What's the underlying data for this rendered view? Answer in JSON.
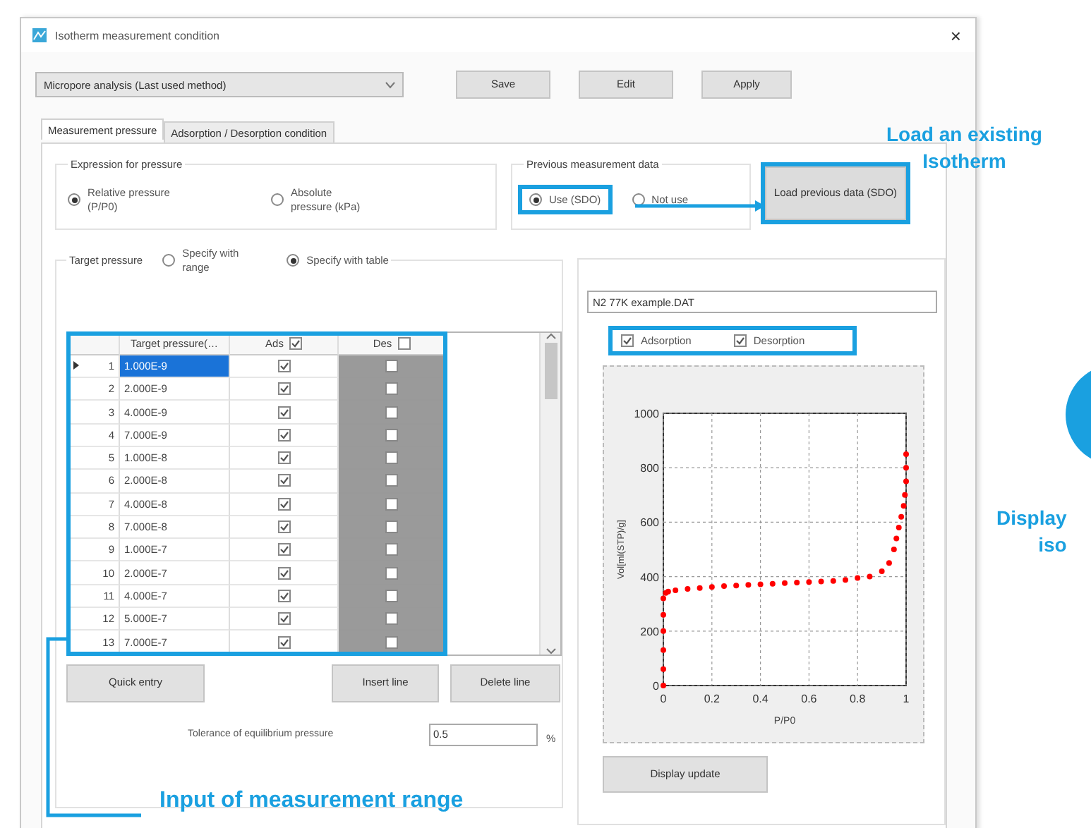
{
  "window": {
    "title": "Isotherm measurement condition",
    "close": "×"
  },
  "method_dropdown": {
    "value": "Micropore analysis (Last used method)"
  },
  "buttons": [
    "Save",
    "Edit",
    "Apply"
  ],
  "tabs": [
    {
      "label": "Measurement pressure",
      "selected": true
    },
    {
      "label": "Adsorption / Desorption condition",
      "selected": false
    }
  ],
  "expression_for_pressure": {
    "title": "Expression for pressure",
    "options": [
      {
        "label": "Relative pressure (P/P0)",
        "selected": true
      },
      {
        "label": "Absolute pressure (kPa)",
        "selected": false
      }
    ]
  },
  "previous_measurement_data": {
    "title": "Previous measurement data",
    "options": [
      {
        "label": "Use (SDO)",
        "selected": true
      },
      {
        "label": "Not use",
        "selected": false
      }
    ],
    "load_button": "Load previous data (SDO)"
  },
  "target_pressure": {
    "label": "Target pressure",
    "options": [
      {
        "label": "Specify with range",
        "selected": false
      },
      {
        "label": "Specify with table",
        "selected": true
      }
    ]
  },
  "table": {
    "columns": [
      {
        "label": "Target pressure(…"
      },
      {
        "label": "Ads",
        "checked": true,
        "disabled": false
      },
      {
        "label": "Des",
        "checked": false,
        "disabled": true
      }
    ],
    "rows": [
      {
        "number": "1",
        "value": "1.000E-9",
        "ads": true,
        "des": false,
        "selected": true
      },
      {
        "number": "2",
        "value": "2.000E-9",
        "ads": true,
        "des": false,
        "selected": false
      },
      {
        "number": "3",
        "value": "4.000E-9",
        "ads": true,
        "des": false,
        "selected": false
      },
      {
        "number": "4",
        "value": "7.000E-9",
        "ads": true,
        "des": false,
        "selected": false
      },
      {
        "number": "5",
        "value": "1.000E-8",
        "ads": true,
        "des": false,
        "selected": false
      },
      {
        "number": "6",
        "value": "2.000E-8",
        "ads": true,
        "des": false,
        "selected": false
      },
      {
        "number": "7",
        "value": "4.000E-8",
        "ads": true,
        "des": false,
        "selected": false
      },
      {
        "number": "8",
        "value": "7.000E-8",
        "ads": true,
        "des": false,
        "selected": false
      },
      {
        "number": "9",
        "value": "1.000E-7",
        "ads": true,
        "des": false,
        "selected": false
      },
      {
        "number": "10",
        "value": "2.000E-7",
        "ads": true,
        "des": false,
        "selected": false
      },
      {
        "number": "11",
        "value": "4.000E-7",
        "ads": true,
        "des": false,
        "selected": false
      },
      {
        "number": "12",
        "value": "5.000E-7",
        "ads": true,
        "des": false,
        "selected": false
      },
      {
        "number": "13",
        "value": "7.000E-7",
        "ads": true,
        "des": false,
        "selected": false
      }
    ]
  },
  "table_buttons": [
    "Quick entry",
    "Insert line",
    "Delete line"
  ],
  "tolerance": {
    "label": "Tolerance of equilibrium pressure",
    "value": "0.5",
    "unit": "%"
  },
  "file_name": "N2 77K example.DAT",
  "series_toggles": [
    {
      "label": "Adsorption",
      "checked": true
    },
    {
      "label": "Desorption",
      "checked": true
    }
  ],
  "chart_data": {
    "type": "scatter",
    "xlabel": "P/P0",
    "ylabel": "Vol[ml(STP)/g]",
    "x": [
      0,
      0,
      0,
      0,
      0,
      0,
      0.01,
      0.02,
      0.05,
      0.1,
      0.15,
      0.2,
      0.25,
      0.3,
      0.35,
      0.4,
      0.45,
      0.5,
      0.55,
      0.6,
      0.65,
      0.7,
      0.75,
      0.8,
      0.85,
      0.9,
      0.93,
      0.95,
      0.96,
      0.97,
      0.98,
      0.99,
      0.995,
      1,
      1,
      1
    ],
    "series": [
      {
        "color": "#ff0000",
        "values": [
          0,
          60,
          130,
          200,
          260,
          320,
          340,
          345,
          350,
          355,
          358,
          362,
          365,
          367,
          370,
          372,
          374,
          376,
          378,
          380,
          382,
          384,
          388,
          395,
          400,
          420,
          450,
          500,
          540,
          580,
          620,
          660,
          700,
          750,
          800,
          850
        ]
      }
    ],
    "grid": true,
    "xlim": [
      0,
      1
    ],
    "ylim": [
      0,
      1000
    ],
    "xticks": [
      0,
      0.2,
      0.4,
      0.6,
      0.8,
      1
    ],
    "yticks": [
      0,
      200,
      400,
      600,
      800,
      1000
    ]
  },
  "display_update_button": "Display update",
  "annotations": [
    {
      "lines": [
        "Load an existing",
        "Isotherm"
      ]
    },
    {
      "lines": [
        "Display",
        "iso"
      ]
    },
    {
      "lines": [
        "Input of measurement range"
      ]
    }
  ]
}
